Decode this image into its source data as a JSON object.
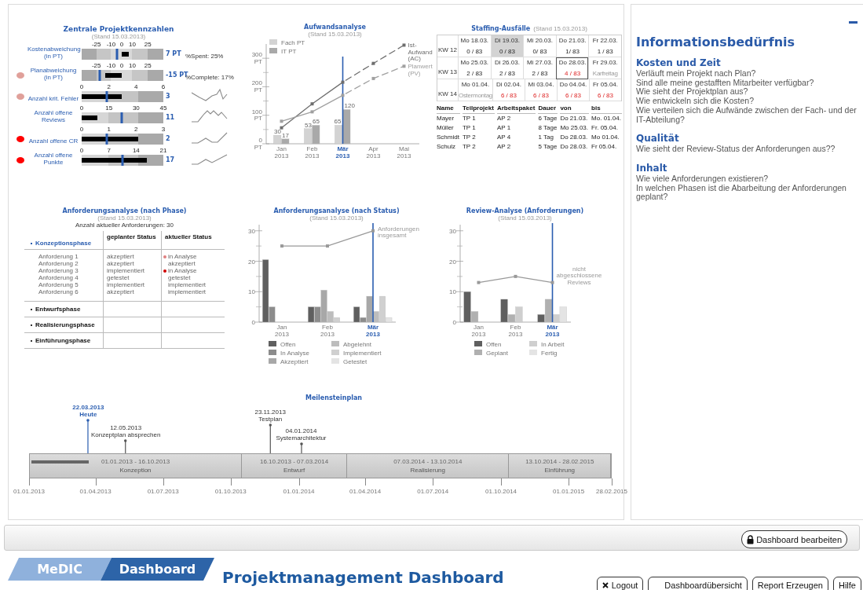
{
  "kpi": {
    "title": "Zentrale Projektkennzahlen",
    "subtitle": "(Stand 15.03.2013)",
    "rows": [
      {
        "label": "Kostenabweichung (in PT)",
        "kind": "deviation",
        "ticks": [
          "-25",
          "-10",
          "0",
          "10",
          "25"
        ],
        "marker": {
          "level": 0.43
        },
        "reading": "7 PT",
        "note": "%Spent: 25%"
      },
      {
        "label": "Planabweichung (in PT)",
        "color": "#e0a09a",
        "kind": "deviation",
        "ticks": [
          "-25",
          "-10",
          "0",
          "10",
          "25"
        ],
        "marker": {
          "level": 0.22
        },
        "reading": "-15 PT",
        "note": "%Complete: 17%"
      },
      {
        "label": "Anzahl krit. Fehler",
        "color": "#e0a09a",
        "kind": "count",
        "ticks": [
          "0",
          "2",
          "4",
          "6"
        ],
        "bar": {
          "level": 0.49
        },
        "marker": {
          "level": 0.31
        },
        "reading": "3",
        "sparkline": true
      },
      {
        "label": "Anzahl offene Reviews",
        "kind": "count",
        "ticks": [
          "0",
          "15",
          "30",
          "45"
        ],
        "bar": {
          "level": 0.19
        },
        "marker": {
          "level": 0.49
        },
        "reading": "11",
        "sparkline": true
      },
      {
        "label": "Anzahl offene CR",
        "color": "#ff0000",
        "kind": "count",
        "ticks": [
          "0",
          "1",
          "2",
          "3"
        ],
        "bar": {
          "level": 0.69
        },
        "marker": {
          "level": 0.31
        },
        "reading": "2",
        "sparkline": true
      },
      {
        "label": "Anzahl offene Punkte",
        "color": "#ff0000",
        "kind": "count",
        "ticks": [
          "0",
          "7",
          "14",
          "21"
        ],
        "bar": {
          "level": 0.8
        },
        "marker": {
          "level": 0.5
        },
        "reading": "17",
        "sparkline": true
      }
    ]
  },
  "effort": {
    "subtitle": "(Stand 15.03.2013)",
    "chart_data": {
      "type": "bar",
      "title": "Aufwandsanalyse",
      "categories": [
        "Jan 2013",
        "Feb 2013",
        "Mär 2013",
        "Apr 2013",
        "Mai 2013"
      ],
      "series": [
        {
          "name": "Fach PT",
          "type": "bar",
          "color": "#d3d3d3",
          "values": [
            30,
            53,
            65,
            null,
            null
          ],
          "value_labels": [
            "30",
            "53",
            "65",
            null,
            null
          ]
        },
        {
          "name": "IT PT",
          "type": "bar",
          "color": "#a9a9a9",
          "values": [
            17,
            65,
            120,
            null,
            null
          ],
          "value_labels": [
            "17",
            "65",
            "120",
            null,
            null
          ]
        },
        {
          "name": "Ist-Aufwand (AC)",
          "type": "line",
          "color": "#6e6e6e",
          "line_style": "dashed",
          "marker": "square",
          "values": [
            56,
            140,
            216,
            282,
            346
          ]
        },
        {
          "name": "Planwert (PV)",
          "type": "line",
          "color": "#a0a0a0",
          "line_style": "dashed",
          "marker": "square",
          "values": [
            79,
            112,
            170,
            229,
            272
          ]
        }
      ],
      "ylim": [
        0,
        350
      ],
      "yticks": [
        {
          "value": 0,
          "label": "0 PT"
        },
        {
          "value": 100,
          "label": "100 PT"
        },
        {
          "value": 200,
          "label": "200 PT"
        },
        {
          "value": 300,
          "label": "300 PT"
        }
      ],
      "stacked": false,
      "legend": "upper left",
      "ref_lines": [
        {
          "axis": "x",
          "value": "Mär 2013",
          "color": "#2a5db0"
        }
      ]
    }
  },
  "staffing": {
    "title": "Staffing-Ausfälle",
    "subtitle": "(Stand 15.03.2013)",
    "weeks": [
      {
        "label": "KW 12",
        "days": [
          {
            "day": "Mo 18.03.",
            "value": "0 / 83",
            "kind": "ok",
            "highlighted": false,
            "outlined": false
          },
          {
            "day": "Di 19.03.",
            "value": "0 / 83",
            "kind": "ok",
            "highlighted": true,
            "outlined": false
          },
          {
            "day": "Mi 20.03.",
            "value": "0/ 83",
            "kind": "ok",
            "highlighted": false,
            "outlined": false
          },
          {
            "day": "Do 21.03.",
            "value": "1/ 83",
            "kind": "ok",
            "highlighted": false,
            "outlined": false
          },
          {
            "day": "Fr 22.03.",
            "value": "1 / 83",
            "kind": "ok",
            "highlighted": false,
            "outlined": false
          }
        ]
      },
      {
        "label": "KW 13",
        "days": [
          {
            "day": "Mo 25.03.",
            "value": "2 / 83",
            "kind": "ok",
            "highlighted": false,
            "outlined": false
          },
          {
            "day": "Di 26.03.",
            "value": "2 / 83",
            "kind": "ok",
            "highlighted": false,
            "outlined": false
          },
          {
            "day": "Mi 27.03.",
            "value": "2 / 83",
            "kind": "ok",
            "highlighted": false,
            "outlined": false
          },
          {
            "day": "Do 28.03.",
            "value": "4 / 83",
            "kind": "alert",
            "highlighted": false,
            "outlined": true
          },
          {
            "day": "Fr 29.03.",
            "value": "Karfreitag",
            "kind": "holiday",
            "highlighted": false,
            "outlined": false
          }
        ]
      },
      {
        "label": "KW 14",
        "days": [
          {
            "day": "Mo 01.04.",
            "value": "Ostermontag",
            "kind": "holiday",
            "highlighted": false,
            "outlined": false
          },
          {
            "day": "Di 02.04.",
            "value": "6 / 83",
            "kind": "alert",
            "highlighted": false,
            "outlined": false
          },
          {
            "day": "Mi 03.04.",
            "value": "6 / 83",
            "kind": "alert",
            "highlighted": false,
            "outlined": false
          },
          {
            "day": "Do 04.04.",
            "value": "6 / 83",
            "kind": "alert",
            "highlighted": false,
            "outlined": false
          },
          {
            "day": "Fr 05.04.",
            "value": "6 / 83",
            "kind": "alert",
            "highlighted": false,
            "outlined": false
          }
        ]
      }
    ],
    "columns": [
      "Name",
      "Teilprojekt",
      "Arbeitspaket",
      "Dauer",
      "von",
      "bis"
    ],
    "rows": [
      [
        "Mayer",
        "TP 1",
        "AP 2",
        "6 Tage",
        "Do 21.03.",
        "Mo. 01.04."
      ],
      [
        "Müller",
        "TP 1",
        "AP 1",
        "8 Tage",
        "Mo 25.03.",
        "Fr. 05.04."
      ],
      [
        "Schmidt",
        "TP 2",
        "AP 4",
        "1 Tag",
        "Do 28.03.",
        "Mo 01.04."
      ],
      [
        "Schulz",
        "TP 2",
        "AP 2",
        "5 Tage",
        "Do 28.03.",
        "Fr 05.04."
      ]
    ]
  },
  "requirements_by_phase": {
    "title": "Anforderungsanalyse (nach Phase)",
    "subtitle": "(Stand 15.03.2013)",
    "summary": "Anzahl aktueller Anforderungen: 30",
    "columns": [
      "geplanter Status",
      "aktueller Status"
    ],
    "phases": [
      {
        "name": "Konzeptionsphase",
        "expanded": true,
        "requirements": [
          {
            "name": "Anforderung 1",
            "planned": "akzeptiert",
            "actual": "in Analyse",
            "color": "#e08080"
          },
          {
            "name": "Anforderung 2",
            "planned": "akzeptiert",
            "actual": "akzeptiert"
          },
          {
            "name": "Anforderung 3",
            "planned": "implementiert",
            "actual": "in Analyse",
            "color": "#d00000"
          },
          {
            "name": "Anforderung 4",
            "planned": "getestet",
            "actual": "getestet"
          },
          {
            "name": "Anforderung 5",
            "planned": "implementiert",
            "actual": "implementiert"
          },
          {
            "name": "Anforderung 6",
            "planned": "akzeptiert",
            "actual": "implementiert"
          }
        ]
      },
      {
        "name": "Entwurfsphase",
        "expanded": false
      },
      {
        "name": "Realisierungsphase",
        "expanded": false
      },
      {
        "name": "Einführungsphase",
        "expanded": false
      }
    ]
  },
  "req_status": {
    "subtitle": "(Stand 15.03.2013)",
    "chart_data": {
      "type": "bar",
      "title": "Anforderungsanalyse (nach Status)",
      "categories": [
        "Jan 2013",
        "Feb 2013",
        "Mär 2013"
      ],
      "series": [
        {
          "name": "Offen",
          "type": "bar",
          "color": "#5f5f5f",
          "values": [
            20.5,
            5,
            5
          ]
        },
        {
          "name": "In Analyse",
          "type": "bar",
          "color": "#8c8c8c",
          "values": [
            5,
            5,
            1.5
          ]
        },
        {
          "name": "Akzeptiert",
          "type": "bar",
          "color": "#a8a8a8",
          "values": [
            null,
            10.5,
            8.5
          ]
        },
        {
          "name": "Abgelehnt",
          "type": "bar",
          "color": "#bdbdbd",
          "values": [
            null,
            3.5,
            3.5
          ]
        },
        {
          "name": "Implementiert",
          "type": "bar",
          "color": "#d0d0d0",
          "values": [
            null,
            1.5,
            8.5
          ]
        },
        {
          "name": "Getestet",
          "type": "bar",
          "color": "#e4e4e4",
          "values": [
            null,
            null,
            1.5
          ]
        },
        {
          "name": "Anforderungen insgesamt",
          "type": "line",
          "color": "#999999",
          "marker": "square",
          "values": [
            25,
            25,
            30
          ]
        }
      ],
      "ylim": [
        0,
        32
      ],
      "yticks": [
        0,
        10,
        20,
        30
      ],
      "stacked": false,
      "legend": "lower center",
      "ref_lines": [
        {
          "axis": "x",
          "value": "Mär 2013",
          "color": "#2a5db0"
        }
      ]
    }
  },
  "reviews": {
    "subtitle": "(Stand 15.03.2013)",
    "chart_data": {
      "type": "bar",
      "title": "Review-Analyse (Anforderungen)",
      "categories": [
        "Jan 2013",
        "Feb 2013",
        "Mär 2013"
      ],
      "series": [
        {
          "name": "Offen",
          "type": "bar",
          "color": "#5f5f5f",
          "values": [
            10,
            7.5,
            2.5
          ]
        },
        {
          "name": "Geplant",
          "type": "bar",
          "color": "#b0b0b0",
          "values": [
            3.5,
            2.5,
            7.5
          ]
        },
        {
          "name": "In Arbeit",
          "type": "bar",
          "color": "#cfcfcf",
          "values": [
            null,
            5,
            2.5
          ]
        },
        {
          "name": "Fertig",
          "type": "bar",
          "color": "#e4e4e4",
          "values": [
            null,
            null,
            5
          ]
        },
        {
          "name": "nicht abgeschlossene Reviews",
          "type": "line",
          "color": "#999999",
          "marker": "square",
          "values": [
            13,
            15,
            13
          ]
        }
      ],
      "ylim": [
        0,
        32
      ],
      "yticks": [
        0,
        10,
        20,
        30
      ],
      "stacked": false,
      "legend": "lower center",
      "ref_lines": [
        {
          "axis": "x",
          "value": "Mär 2013",
          "color": "#2a5db0"
        }
      ]
    }
  },
  "milestones": {
    "title": "Meilensteinplan",
    "level": 0.098,
    "events": [
      {
        "date": "22.03.2013",
        "label": "Heute",
        "kind": "today"
      },
      {
        "date": "12.05.2013",
        "label": "Konzeptplan absprechen",
        "kind": "milestone"
      },
      {
        "date": "23.11.2013",
        "label": "Testplan",
        "kind": "milestone"
      },
      {
        "date": "04.01.2014",
        "label": "Systemarchitektur",
        "kind": "milestone"
      }
    ],
    "phases": [
      {
        "dates": "01.01.2013 - 16.10.2013",
        "name": "Konzeption"
      },
      {
        "dates": "16.10.2013 - 07.03.2014",
        "name": "Entwurf"
      },
      {
        "dates": "07.03.2014 - 13.10.2014",
        "name": "Realisierung"
      },
      {
        "dates": "13.10.2014 - 28.02.2015",
        "name": "Einführung"
      }
    ],
    "axis": [
      "01.01.2013",
      "01.04.2013",
      "01.07.2013",
      "01.10.2013",
      "01.01.2014",
      "01.04.2014",
      "01.07.2014",
      "01.10.2014",
      "01.01.2015",
      "28.02.2015"
    ]
  },
  "info": {
    "title": "Informationsbedürfnis",
    "sections": [
      {
        "heading": "Kosten und Zeit",
        "lines": [
          "Verläuft mein Projekt nach Plan?",
          "Sind alle meine gestafften Mitarbeiter verfügbar?",
          "Wie sieht der Projektplan aus?",
          "Wie entwickeln sich die Kosten?",
          "Wie verteilen sich die Aufwände zwischen der Fach- und der IT-Abteilung?"
        ]
      },
      {
        "heading": "Qualität",
        "lines": [
          "Wie sieht der Review-Status der Anforderungen aus??"
        ]
      },
      {
        "heading": "Inhalt",
        "lines": [
          "Wie viele Anforderungen existieren?",
          "In welchen Phasen ist die Abarbeitung der Anforderungen geplant?"
        ]
      }
    ]
  },
  "toolbar": {
    "button": "Dashboard bearbeiten"
  },
  "footer": {
    "logo": [
      "MeDIC",
      "Dashboard"
    ],
    "title": "Projektmanagement Dashboard",
    "buttons": [
      {
        "label": "Logout",
        "kind": "logout"
      },
      {
        "label": "Dashboardübersicht",
        "kind": "overview"
      },
      {
        "label": "Report Erzeugen",
        "kind": "plain"
      },
      {
        "label": "Hilfe",
        "kind": "plain"
      }
    ]
  }
}
